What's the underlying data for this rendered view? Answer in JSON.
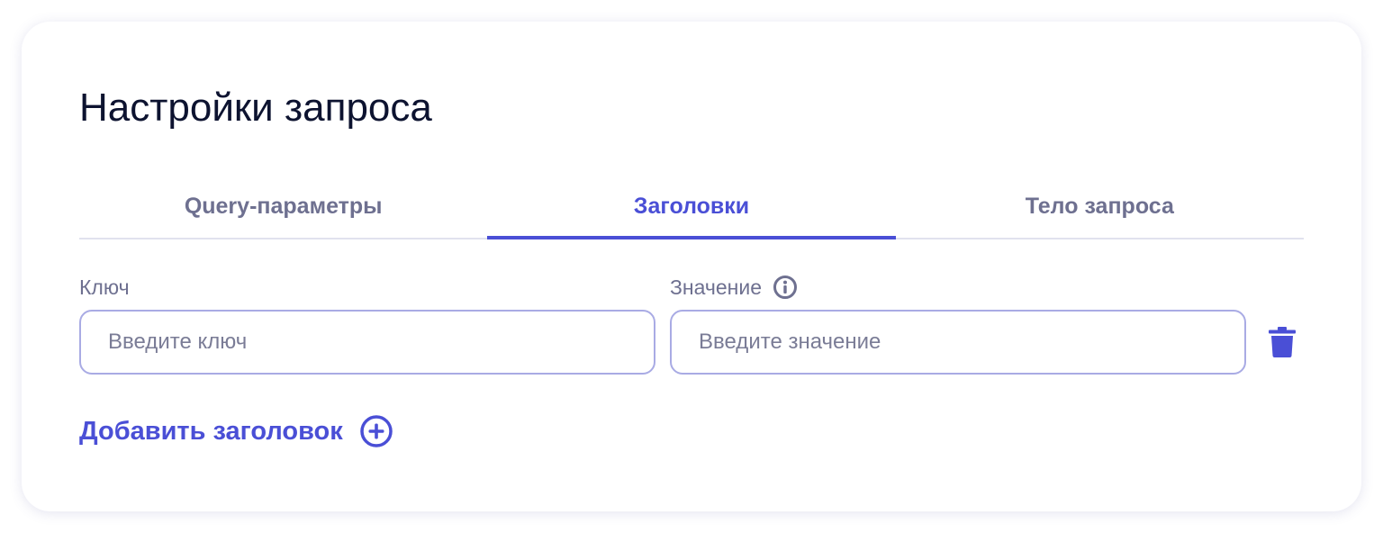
{
  "card": {
    "title": "Настройки запроса"
  },
  "tabs": [
    {
      "label": "Query-параметры",
      "active": false
    },
    {
      "label": "Заголовки",
      "active": true
    },
    {
      "label": "Тело запроса",
      "active": false
    }
  ],
  "headers": {
    "key_label": "Ключ",
    "value_label": "Значение",
    "key_placeholder": "Введите ключ",
    "value_placeholder": "Введите значение",
    "info_icon": "info-icon",
    "delete_icon": "trash-icon"
  },
  "add_header": {
    "label": "Добавить заголовок",
    "icon": "plus-circle-icon"
  },
  "colors": {
    "accent": "#4a4fd6",
    "text_primary": "#0d1330",
    "text_muted": "#6e7090",
    "input_border": "#a9abe4",
    "divider": "#e1e2ee"
  }
}
